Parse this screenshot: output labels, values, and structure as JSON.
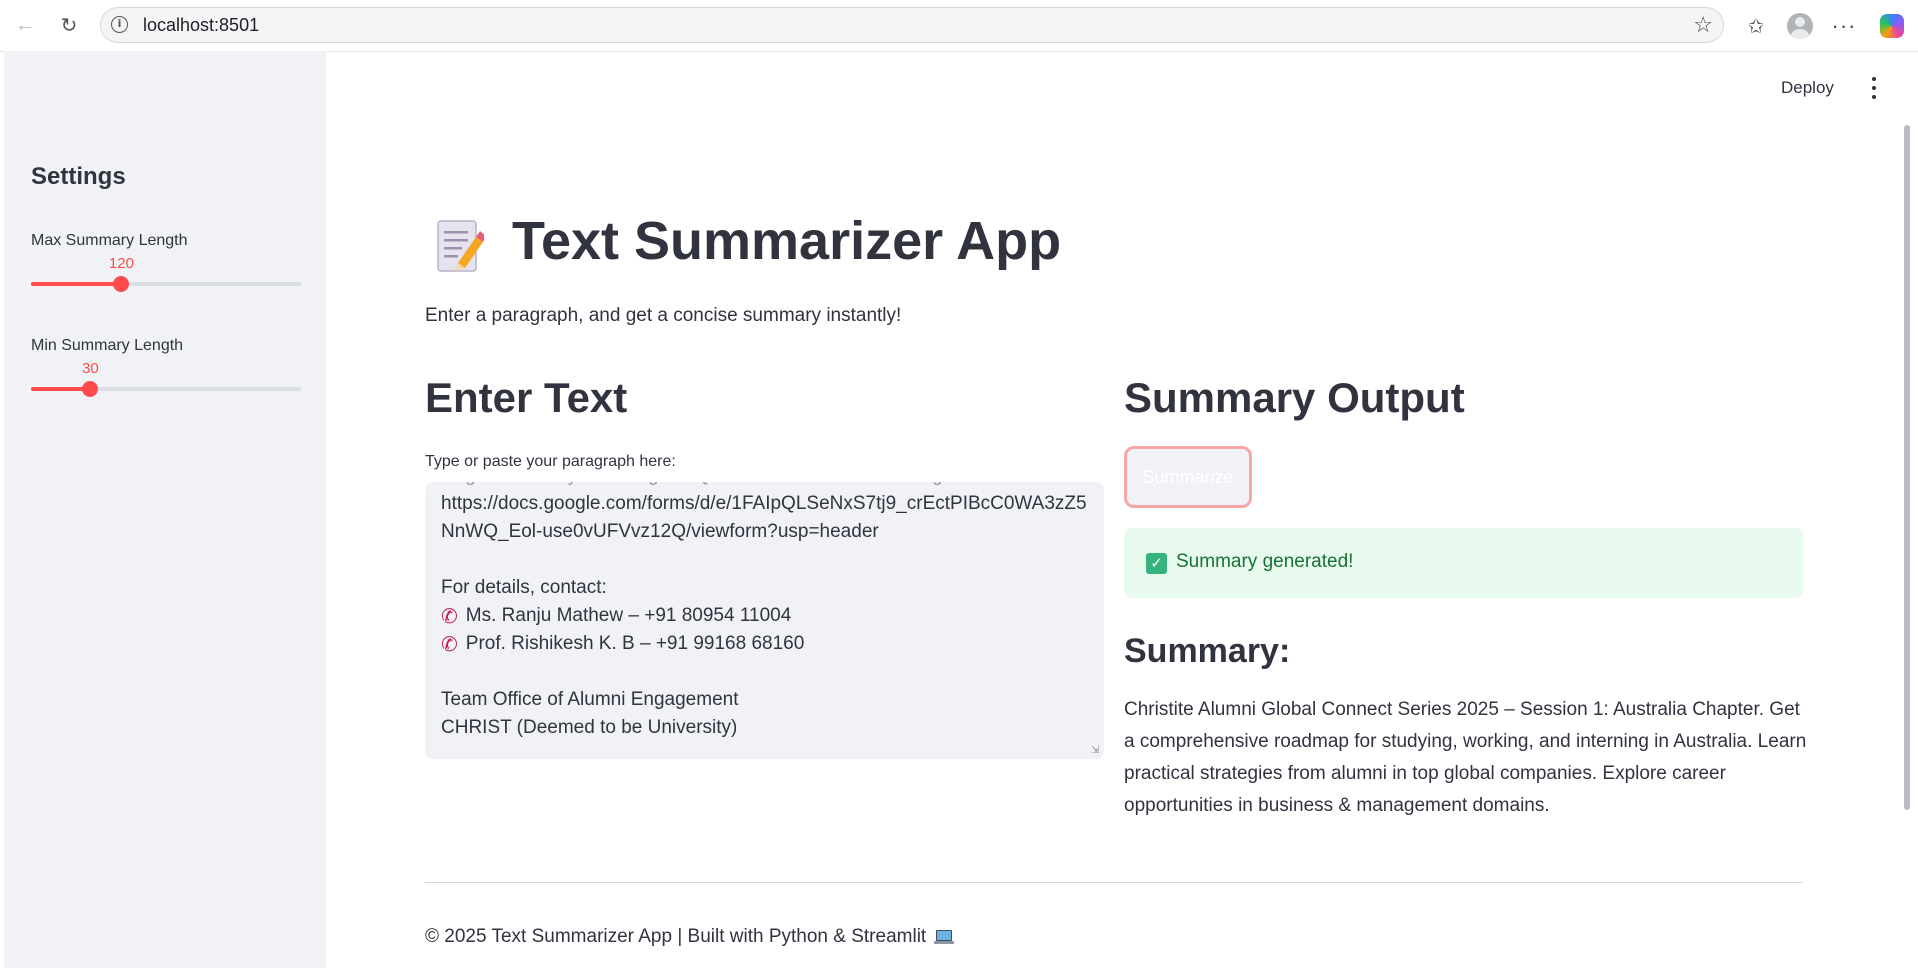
{
  "browser": {
    "url": "localhost:8501"
  },
  "sidebar": {
    "title": "Settings",
    "sliders": [
      {
        "label": "Max Summary Length",
        "value": "120",
        "fraction": 0.335
      },
      {
        "label": "Min Summary Length",
        "value": "30",
        "fraction": 0.22
      }
    ]
  },
  "header": {
    "deploy_label": "Deploy"
  },
  "main": {
    "title": "Text Summarizer App",
    "subtitle": "Enter a paragraph, and get a concise summary instantly!",
    "input_section": {
      "heading": "Enter Text",
      "label": "Type or paste your paragraph here:",
      "lines": [
        "Register now by scanning the QR code or click on the link given below:",
        "https://docs.google.com/forms/d/e/1FAIpQLSeNxS7tj9_crEctPIBcC0WA3zZ5",
        "NnWQ_Eol-use0vUFVvz12Q/viewform?usp=header",
        "",
        "For details, contact:",
        "Ms. Ranju Mathew – +91 80954 11004",
        "Prof. Rishikesh K. B – +91 99168 68160",
        "",
        "Team Office of Alumni Engagement",
        "CHRIST (Deemed to be University)"
      ]
    },
    "output_section": {
      "heading": "Summary Output",
      "button_label": "Summarize",
      "success_message": "Summary generated!",
      "summary_heading": "Summary:",
      "summary_text": "Christite Alumni Global Connect Series 2025 – Session 1: Australia Chapter. Get a comprehensive roadmap for studying, working, and interning in Australia. Learn practical strategies from alumni in top global companies. Explore career opportunities in business & management domains."
    },
    "footer": "© 2025 Text Summarizer App | Built with Python & Streamlit"
  },
  "colors": {
    "accent": "#ff4b4b",
    "sidebar_bg": "#f0f2f6",
    "success_bg": "#e8f9ee",
    "success_text": "#177233",
    "text": "#31333f"
  }
}
